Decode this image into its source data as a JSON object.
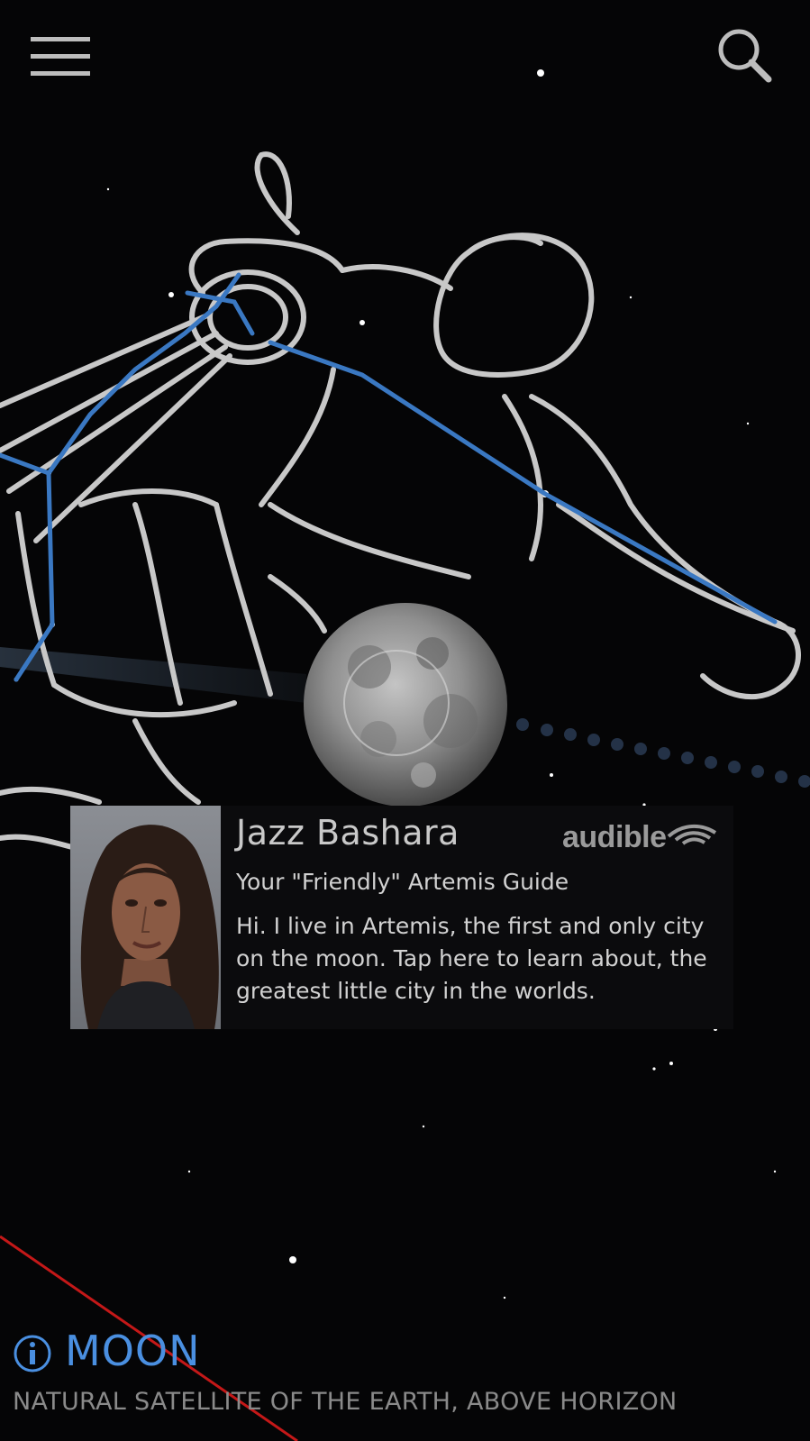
{
  "toolbar": {
    "menu_icon": "hamburger-menu-icon",
    "search_icon": "search-icon"
  },
  "sky": {
    "constellation_art": "aquarius-water-bearer",
    "colors": {
      "background": "#050506",
      "constellation_line": "#3a78c2",
      "artwork_outline": "#c8c8c8",
      "ecliptic_line": "#c41818",
      "moon_path_dots": "#2a3a52"
    },
    "moon_label": "Moon"
  },
  "guide_card": {
    "name": "Jazz Bashara",
    "brand": "audible",
    "subtitle": "Your \"Friendly\" Artemis Guide",
    "description": "Hi. I live in Artemis, the first and only city on the moon. Tap here to learn about, the greatest little city in the worlds."
  },
  "selected_object": {
    "info_icon": "info-icon",
    "name": "MOON",
    "description": "NATURAL SATELLITE OF THE EARTH, ABOVE HORIZON",
    "accent_color": "#4a8fe0"
  }
}
